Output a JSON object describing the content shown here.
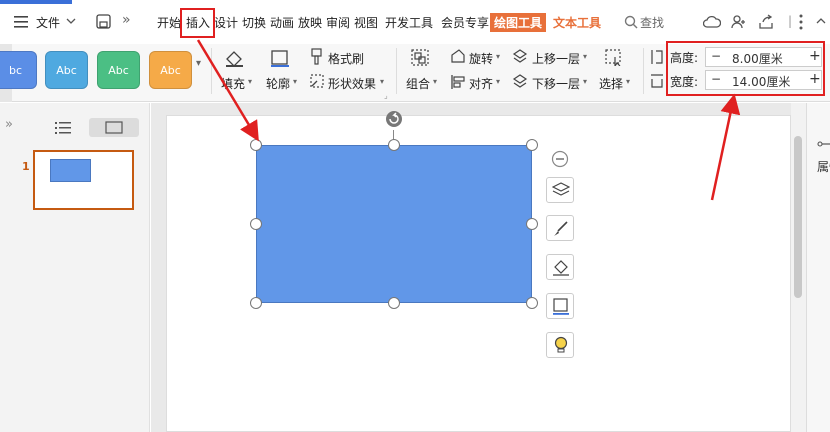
{
  "menubar": {
    "file_label": "文件",
    "tabs": [
      "开始",
      "插入",
      "设计",
      "切换",
      "动画",
      "放映",
      "审阅",
      "视图",
      "开发工具",
      "会员专享"
    ],
    "active_tab": "绘图工具",
    "text_tool_tab": "文本工具",
    "search_label": "查找"
  },
  "ribbon": {
    "style_samples": [
      "bc",
      "Abc",
      "Abc",
      "Abc"
    ],
    "style_colors": [
      "#5b8ee6",
      "#4fa9e0",
      "#4bbf84",
      "#f5aa48"
    ],
    "fill_label": "填充",
    "outline_label": "轮廓",
    "format_painter_label": "格式刷",
    "shape_effects_label": "形状效果",
    "group_label": "组合",
    "rotate_label": "旋转",
    "align_label": "对齐",
    "bring_forward_label": "上移一层",
    "send_backward_label": "下移一层",
    "select_label": "选择",
    "height_label": "高度:",
    "height_value": "8.00厘米",
    "width_label": "宽度:",
    "width_value": "14.00厘米",
    "minus": "−",
    "plus": "+"
  },
  "leftpanel": {
    "expand_label": "»",
    "slide_number": "1"
  },
  "rightpanel": {
    "label": "属性"
  },
  "colors": {
    "shape_fill": "#6197e8",
    "shape_border": "#4a78c0",
    "accent_orange": "#e8703a",
    "annotation_red": "#e02020"
  }
}
